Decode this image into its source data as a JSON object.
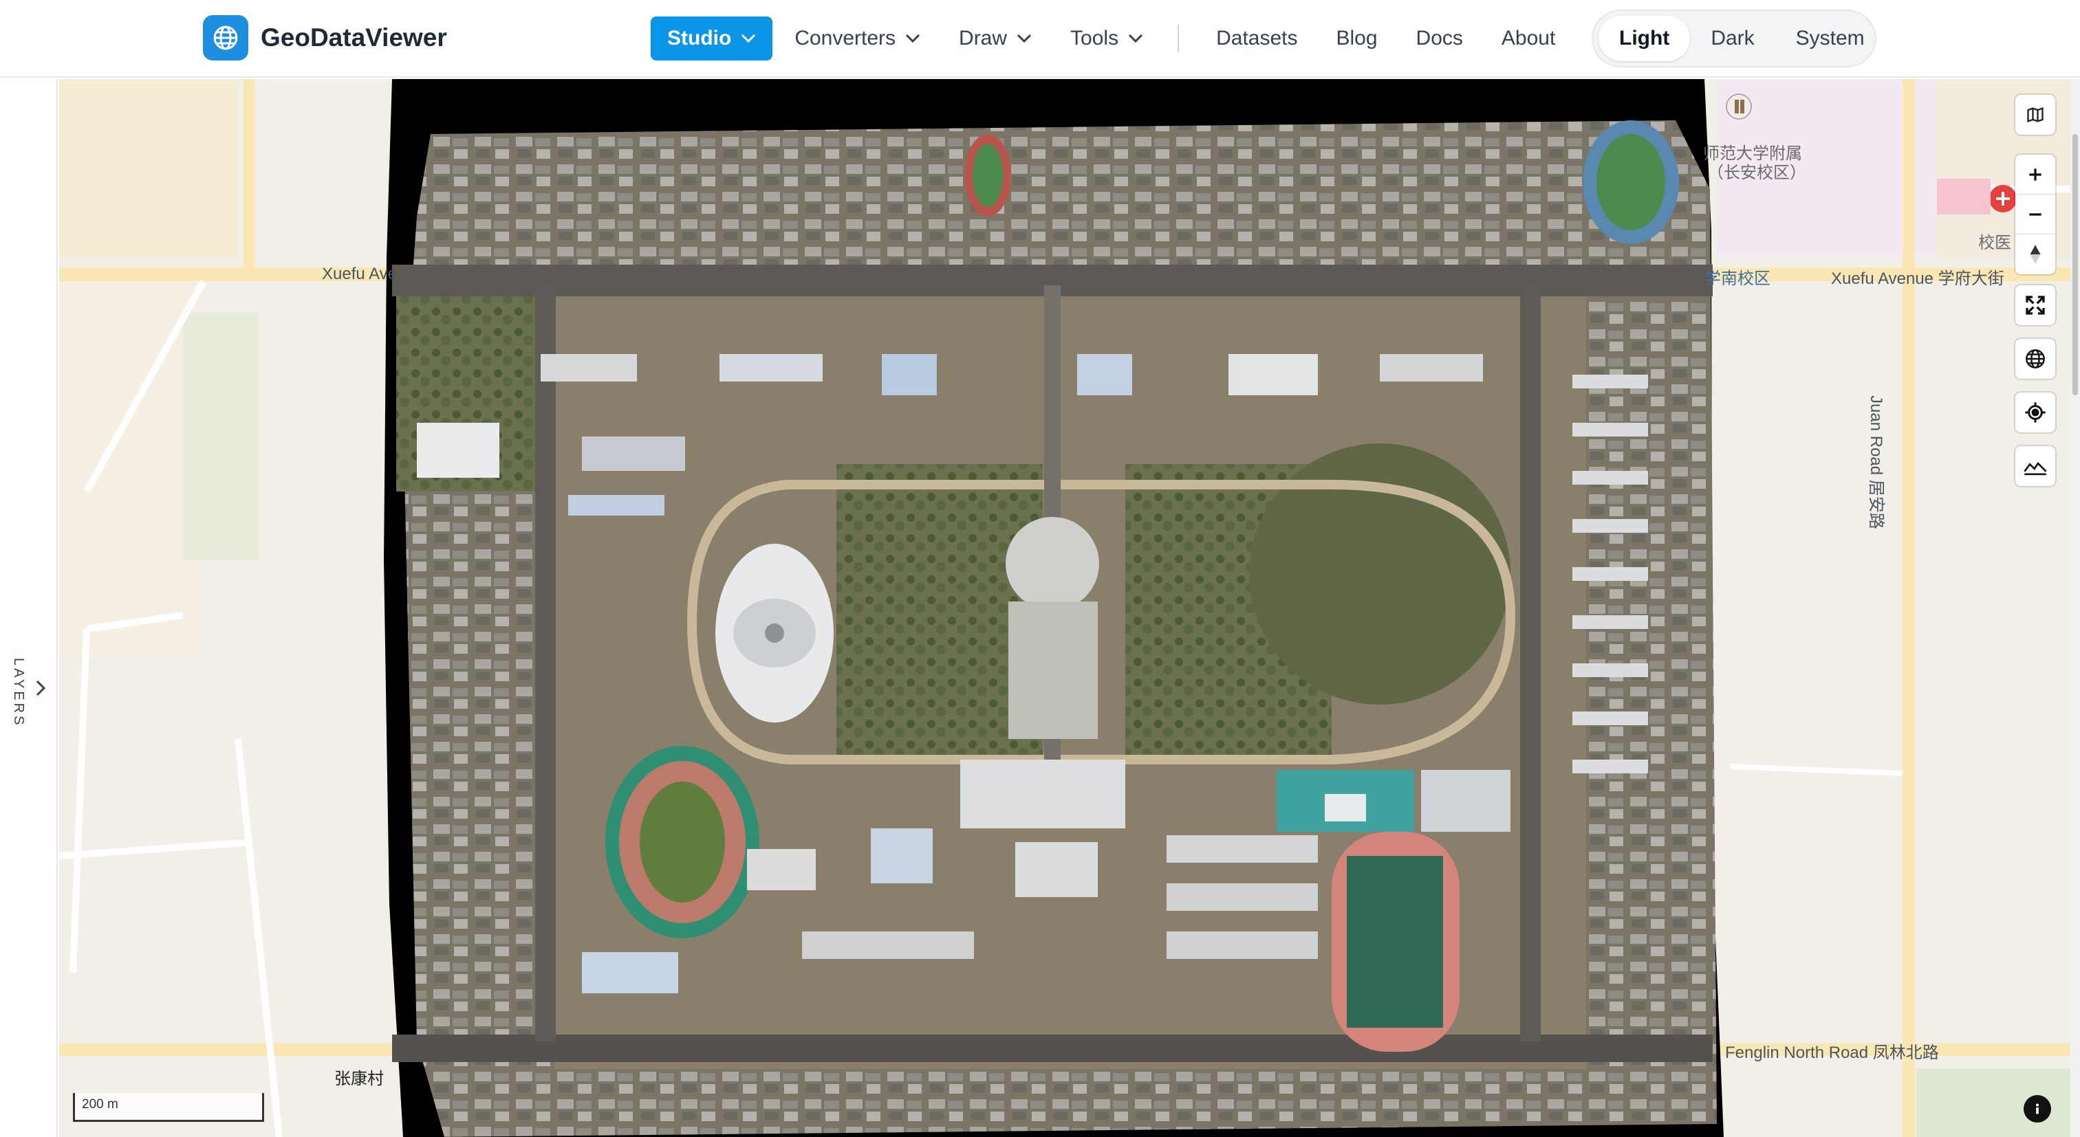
{
  "header": {
    "brand": {
      "name": "GeoDataViewer",
      "icon": "globe-icon",
      "accent": "#1d8fe0"
    },
    "nav": [
      {
        "label": "Studio",
        "active": true,
        "dropdown": true
      },
      {
        "label": "Converters",
        "active": false,
        "dropdown": true
      },
      {
        "label": "Draw",
        "active": false,
        "dropdown": true
      },
      {
        "label": "Tools",
        "active": false,
        "dropdown": true
      }
    ],
    "links": [
      "Datasets",
      "Blog",
      "Docs",
      "About"
    ],
    "theme": {
      "options": [
        "Light",
        "Dark",
        "System"
      ],
      "selected": "Light"
    },
    "active_color": "#0a95e6"
  },
  "sidebar": {
    "layers_label": "LAYERS",
    "toggle_icon": "chevron-right-icon"
  },
  "map": {
    "labels": {
      "xuefu_west": "Xuefu Ave",
      "xuefu_east": "Xuefu Avenue 学府大街",
      "south_campus": "学南校区",
      "affiliated_school_1": "师范大学附属",
      "affiliated_school_2": "（长安校区）",
      "hospital_campus": "校医",
      "juan_road": "Juan Road 居安路",
      "fenglin_road": "Fenglin North Road 凤林北路",
      "village": "张康村"
    },
    "scale_label": "200 m",
    "controls": [
      "basemap-icon",
      "zoom-in-icon",
      "zoom-out-icon",
      "compass-icon",
      "fullscreen-icon",
      "globe-icon",
      "locate-icon",
      "terrain-icon"
    ],
    "info_icon": "info-icon"
  }
}
